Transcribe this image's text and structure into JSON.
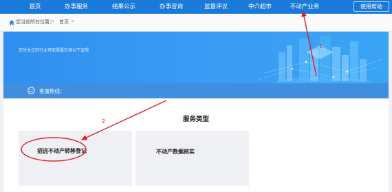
{
  "nav": {
    "items": [
      "首页",
      "办事服务",
      "结果公示",
      "办事咨询",
      "监督评议",
      "中介超市",
      "不动产业务"
    ],
    "help": "使用帮助"
  },
  "breadcrumb": {
    "location_label": "您当前所在位置：",
    "separator": ">",
    "home": "首页"
  },
  "banner": {
    "text": "您所关注的行业可能需要办理以下证照",
    "hotline": "客服热线："
  },
  "content": {
    "section_title": "服务类型",
    "cards": [
      "招远不动产转移登记",
      "不动产数据核实"
    ]
  },
  "annotations": {
    "step1": "1",
    "step2": "2",
    "color": "#e02020"
  },
  "colors": {
    "nav_bg": "#1a7ad9",
    "banner_bg": "#2f8ff0",
    "hotline_bg": "#3f8fe0"
  }
}
